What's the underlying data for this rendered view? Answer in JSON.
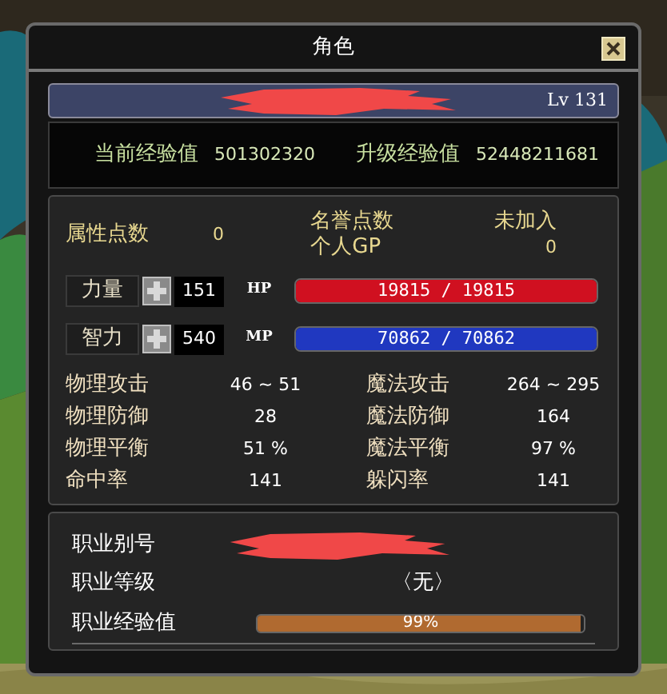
{
  "window": {
    "title": "角色"
  },
  "character": {
    "level": "Lv 131"
  },
  "experience": [
    {
      "label": "当前经验值",
      "value": "501302320"
    },
    {
      "label": "升级经验值",
      "value": "52448211681"
    }
  ],
  "points": {
    "label": "属性点数",
    "value": "0"
  },
  "honor": {
    "label": "名誉点数",
    "value": "未加入",
    "gp_label": "个人GP",
    "gp_value": "0"
  },
  "attributes": [
    {
      "label": "力量",
      "value": "151",
      "bar_label": "HP",
      "bar_text": "19815 / 19815",
      "level": 1,
      "color": "#d01020"
    },
    {
      "label": "智力",
      "value": "540",
      "bar_label": "MP",
      "bar_text": "70862 / 70862",
      "level": 1,
      "color": "#2038c0"
    }
  ],
  "stats": [
    {
      "left_label": "物理攻击",
      "left_value": "46 ~ 51",
      "right_label": "魔法攻击",
      "right_value": "264 ~ 295"
    },
    {
      "left_label": "物理防御",
      "left_value": "28",
      "right_label": "魔法防御",
      "right_value": "164"
    },
    {
      "left_label": "物理平衡",
      "left_value": "51 %",
      "right_label": "魔法平衡",
      "right_value": "97 %"
    },
    {
      "left_label": "命中率",
      "left_value": "141",
      "right_label": "躲闪率",
      "right_value": "141"
    }
  ],
  "job": {
    "alias_label": "职业别号",
    "grade_label": "职业等级",
    "grade_value": "〈无〉",
    "exp_label": "职业经验值",
    "exp_text": "99%",
    "level": 0.99
  }
}
